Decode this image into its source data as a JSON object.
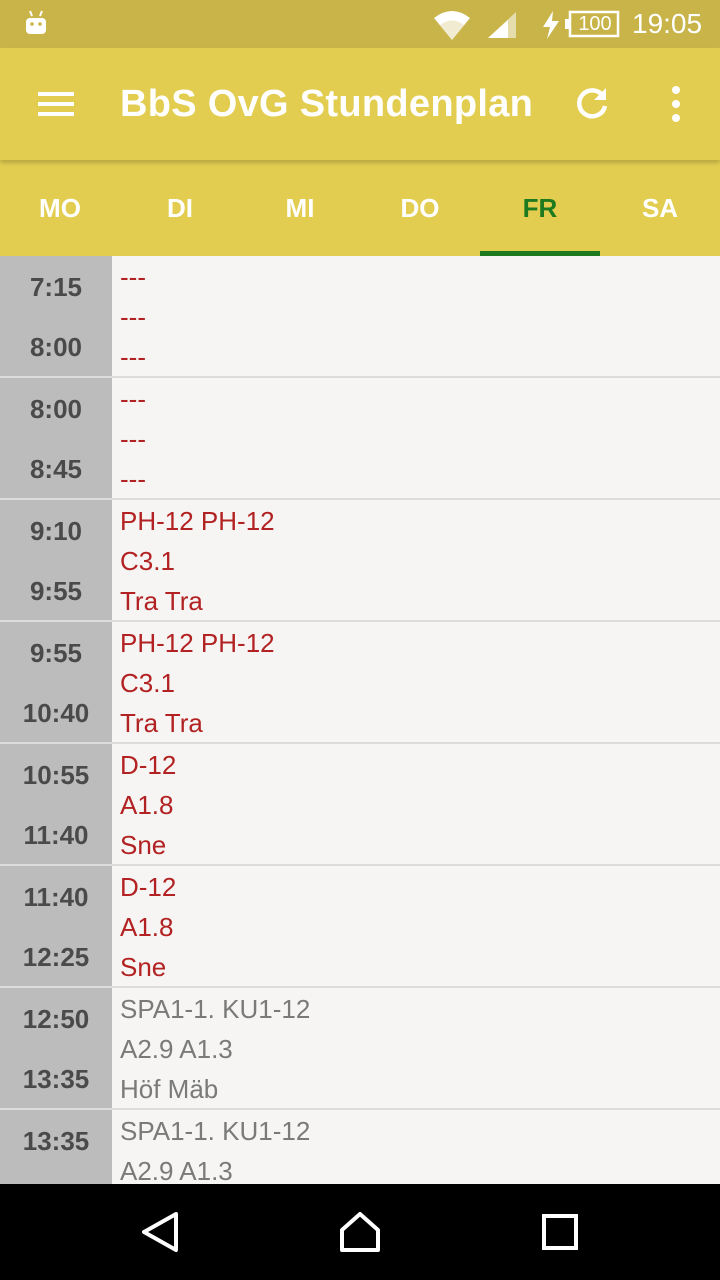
{
  "status_bar": {
    "battery_level": "100",
    "time": "19:05",
    "icons": [
      "android-icon",
      "wifi-icon",
      "signal-icon",
      "charging-icon",
      "battery-icon"
    ]
  },
  "app_bar": {
    "title": "BbS OvG Stundenplan",
    "icons": [
      "menu-icon",
      "refresh-icon",
      "overflow-menu-icon"
    ]
  },
  "tabs": [
    {
      "label": "MO",
      "active": false
    },
    {
      "label": "DI",
      "active": false
    },
    {
      "label": "MI",
      "active": false
    },
    {
      "label": "DO",
      "active": false
    },
    {
      "label": "FR",
      "active": true
    },
    {
      "label": "SA",
      "active": false
    }
  ],
  "colors": {
    "status_bar": "#c8b448",
    "app_bar": "#e2cd50",
    "active_tab": "#1e7a1e",
    "time_column": "#bcbcbc",
    "entry_text_red": "#b22222",
    "entry_text_grey": "#7a7a7a"
  },
  "schedule": [
    {
      "start": "7:15",
      "end": "8:00",
      "lines": [
        "---",
        "---",
        "---"
      ],
      "style": "red"
    },
    {
      "start": "8:00",
      "end": "8:45",
      "lines": [
        "---",
        "---",
        "---"
      ],
      "style": "red"
    },
    {
      "start": "9:10",
      "end": "9:55",
      "lines": [
        "PH-12 PH-12",
        "C3.1",
        "Tra Tra"
      ],
      "style": "red"
    },
    {
      "start": "9:55",
      "end": "10:40",
      "lines": [
        "PH-12 PH-12",
        "C3.1",
        "Tra Tra"
      ],
      "style": "red"
    },
    {
      "start": "10:55",
      "end": "11:40",
      "lines": [
        "D-12",
        "A1.8",
        "Sne"
      ],
      "style": "red"
    },
    {
      "start": "11:40",
      "end": "12:25",
      "lines": [
        "D-12",
        "A1.8",
        "Sne"
      ],
      "style": "red"
    },
    {
      "start": "12:50",
      "end": "13:35",
      "lines": [
        "SPA1-1. KU1-12",
        "A2.9 A1.3",
        "Höf Mäb"
      ],
      "style": "grey"
    },
    {
      "start": "13:35",
      "end": "",
      "lines": [
        "SPA1-1. KU1-12",
        "A2.9 A1.3",
        ""
      ],
      "style": "grey"
    }
  ],
  "nav_bar": {
    "icons": [
      "back-icon",
      "home-icon",
      "recents-icon"
    ]
  }
}
